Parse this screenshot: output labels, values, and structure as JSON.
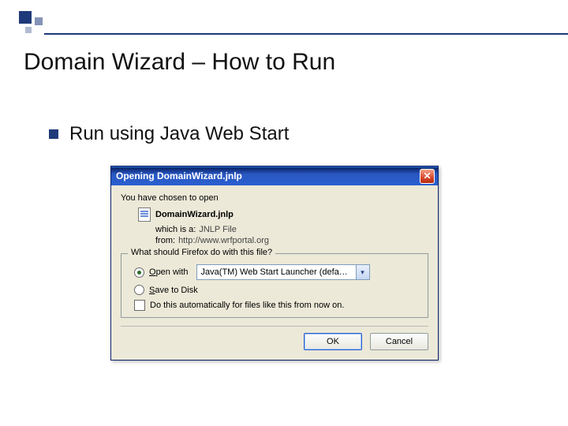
{
  "slide": {
    "title": "Domain Wizard – How to Run",
    "bullet": "Run using Java Web Start"
  },
  "dialog": {
    "title": "Opening DomainWizard.jnlp",
    "intro": "You have chosen to open",
    "filename": "DomainWizard.jnlp",
    "which_is_key": "which is a:",
    "which_is_val": "JNLP File",
    "from_key": "from:",
    "from_val": "http://www.wrfportal.org",
    "group_legend": "What should Firefox do with this file?",
    "open_with_prefix": "O",
    "open_with_rest": "pen with",
    "open_with_value": "Java(TM) Web Start Launcher (defa…",
    "save_prefix": "S",
    "save_rest": "ave to Disk",
    "auto_label": "Do this automatically for files like this from now on.",
    "ok": "OK",
    "cancel": "Cancel"
  }
}
